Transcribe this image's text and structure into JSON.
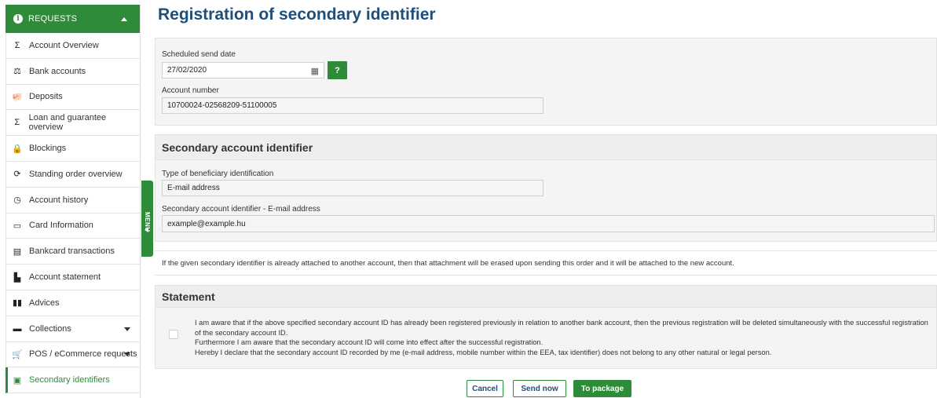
{
  "sidebar": {
    "header": "REQUESTS",
    "items": [
      {
        "label": "Account Overview",
        "icon": "sigma-icon",
        "glyph": "Σ"
      },
      {
        "label": "Bank accounts",
        "icon": "scales-icon",
        "glyph": "⚖"
      },
      {
        "label": "Deposits",
        "icon": "piggy-bank-icon",
        "glyph": "🐖"
      },
      {
        "label": "Loan and guarantee overview",
        "icon": "sigma-icon",
        "glyph": "Σ"
      },
      {
        "label": "Blockings",
        "icon": "lock-icon",
        "glyph": "🔒"
      },
      {
        "label": "Standing order overview",
        "icon": "refresh-icon",
        "glyph": "⟳"
      },
      {
        "label": "Account history",
        "icon": "clock-icon",
        "glyph": "◷"
      },
      {
        "label": "Card Information",
        "icon": "card-icon",
        "glyph": "▭"
      },
      {
        "label": "Bankcard transactions",
        "icon": "card-list-icon",
        "glyph": "▤"
      },
      {
        "label": "Account statement",
        "icon": "pdf-icon",
        "glyph": "▙"
      },
      {
        "label": "Advices",
        "icon": "book-icon",
        "glyph": "▮▮"
      },
      {
        "label": "Collections",
        "icon": "wallet-icon",
        "glyph": "▬"
      },
      {
        "label": "POS / eCommerce requests",
        "icon": "cart-icon",
        "glyph": "🛒"
      },
      {
        "label": "Secondary identifiers",
        "icon": "id-card-icon",
        "glyph": "▣"
      }
    ],
    "menu_tab": "MENU"
  },
  "page": {
    "title": "Registration of secondary identifier"
  },
  "form": {
    "send_date_label": "Scheduled send date",
    "send_date_value": "27/02/2020",
    "help_label": "?",
    "account_number_label": "Account number",
    "account_number_value": "10700024-02568209-51100005"
  },
  "secondary": {
    "heading": "Secondary account identifier",
    "type_label": "Type of beneficiary identification",
    "type_value": "E-mail address",
    "email_label": "Secondary account identifier - E-mail address",
    "email_value": "example@example.hu"
  },
  "notice": "If the given secondary identifier is already attached to another account, then that attachment will be erased upon sending this order and it will be attached to the new account.",
  "statement": {
    "heading": "Statement",
    "line1": "I am aware that if the above specified secondary account ID has already been registered previously in relation to another bank account, then the previous registration will be deleted simultaneously with the successful registration of the secondary account ID.",
    "line2": "Furthermore I am aware that the secondary account ID will come into effect after the successful registration.",
    "line3": "Hereby I declare that the secondary account ID recorded by me (e-mail address, mobile number within the EEA, tax identifier) does not belong to any other natural or legal person."
  },
  "buttons": {
    "cancel": "Cancel",
    "send_now": "Send now",
    "to_package": "To package"
  },
  "colors": {
    "accent_green": "#2e8b3a",
    "title_blue": "#1f4e79"
  }
}
